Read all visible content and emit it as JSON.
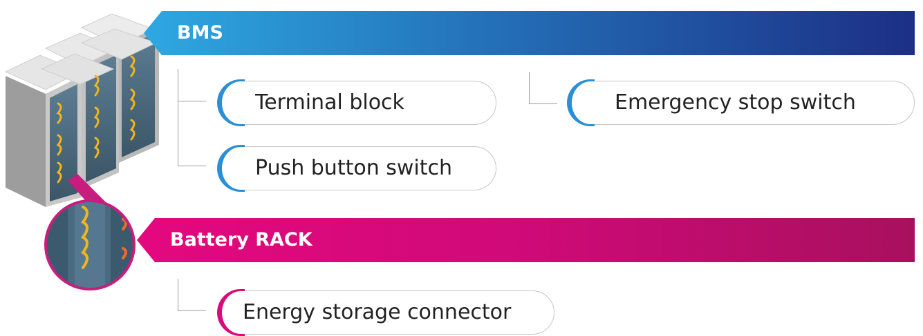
{
  "sections": {
    "bms": {
      "label": "BMS",
      "color": "#2470b8",
      "items": [
        "Terminal block",
        "Push button switch",
        "Emergency stop switch"
      ]
    },
    "rack": {
      "label": "Battery RACK",
      "color": "#e4087f",
      "items": [
        "Energy storage connector"
      ]
    }
  },
  "illustration": {
    "subject": "battery-rack-cabinets-icon"
  }
}
